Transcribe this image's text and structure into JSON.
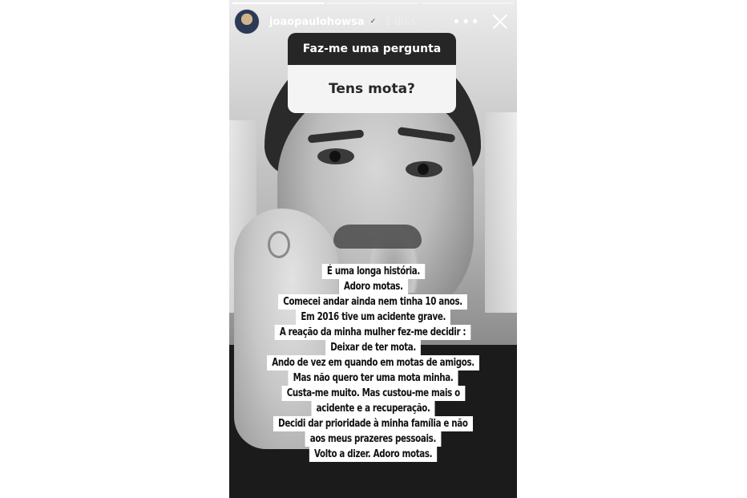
{
  "story": {
    "username": "joaopaulohowsa",
    "time": "1 dias",
    "verified_icon": "verified-badge-icon",
    "progress_segments": 3,
    "progress_completed": 1
  },
  "question_sticker": {
    "title": "Faz-me uma pergunta",
    "question": "Tens mota?"
  },
  "answer_lines": [
    "É uma longa história.",
    "Adoro motas.",
    "Comecei andar ainda nem tinha 10 anos.",
    "Em 2016 tive um acidente grave.",
    "A reação da minha mulher fez-me decidir :",
    "Deixar de ter mota.",
    "Ando de vez em quando em motas de amigos.",
    "Mas não quero ter uma mota minha.",
    "Custa-me muito. Mas custou-me mais o",
    "acidente e a recuperação.",
    "Decidi dar prioridade à minha família e não",
    "aos meus prazeres pessoais.",
    "Volto a dizer. Adoro motas."
  ],
  "controls": {
    "more_icon": "more-options-icon",
    "more_glyph": "•••",
    "close_icon": "close-icon"
  }
}
